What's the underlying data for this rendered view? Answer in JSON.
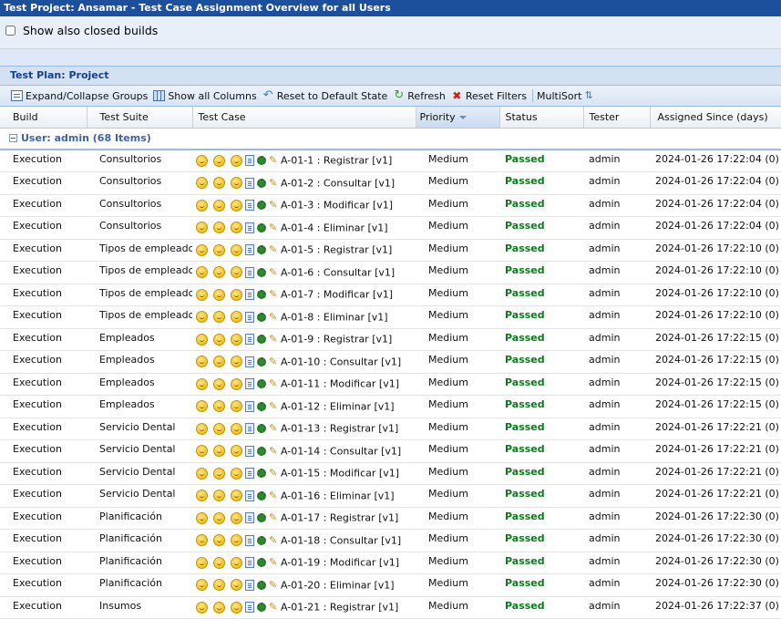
{
  "window": {
    "title": "Test Project: Ansamar - Test Case Assignment Overview for all Users"
  },
  "options": {
    "show_closed_label": "Show also closed builds",
    "show_closed_checked": false
  },
  "panel": {
    "title": "Test Plan: Project"
  },
  "toolbar": {
    "expand_label": "Expand/Collapse Groups",
    "show_columns_label": "Show all Columns",
    "reset_label": "Reset to Default State",
    "refresh_label": "Refresh",
    "reset_filters_label": "Reset Filters",
    "multisort_label": "MultiSort"
  },
  "columns": [
    "Build",
    "Test Suite",
    "Test Case",
    "Priority",
    "Status",
    "Tester",
    "Assigned Since (days)"
  ],
  "sorted_column": "Priority",
  "group": {
    "label": "User: admin (68 Items)"
  },
  "colors": {
    "status_passed": "#0a7a1a",
    "header_bar": "#1c4f9c",
    "group_text": "#3b64a6"
  },
  "rows": [
    {
      "build": "Execution",
      "suite": "Consultorios",
      "testcase": "A-01-1 : Registrar [v1]",
      "priority": "Medium",
      "status": "Passed",
      "tester": "admin",
      "assigned": "2024-01-26 17:22:04 (0)"
    },
    {
      "build": "Execution",
      "suite": "Consultorios",
      "testcase": "A-01-2 : Consultar [v1]",
      "priority": "Medium",
      "status": "Passed",
      "tester": "admin",
      "assigned": "2024-01-26 17:22:04 (0)"
    },
    {
      "build": "Execution",
      "suite": "Consultorios",
      "testcase": "A-01-3 : Modificar [v1]",
      "priority": "Medium",
      "status": "Passed",
      "tester": "admin",
      "assigned": "2024-01-26 17:22:04 (0)"
    },
    {
      "build": "Execution",
      "suite": "Consultorios",
      "testcase": "A-01-4 : Eliminar [v1]",
      "priority": "Medium",
      "status": "Passed",
      "tester": "admin",
      "assigned": "2024-01-26 17:22:04 (0)"
    },
    {
      "build": "Execution",
      "suite": "Tipos de empleados",
      "testcase": "A-01-5 : Registrar [v1]",
      "priority": "Medium",
      "status": "Passed",
      "tester": "admin",
      "assigned": "2024-01-26 17:22:10 (0)"
    },
    {
      "build": "Execution",
      "suite": "Tipos de empleados",
      "testcase": "A-01-6 : Consultar [v1]",
      "priority": "Medium",
      "status": "Passed",
      "tester": "admin",
      "assigned": "2024-01-26 17:22:10 (0)"
    },
    {
      "build": "Execution",
      "suite": "Tipos de empleados",
      "testcase": "A-01-7 : Modificar [v1]",
      "priority": "Medium",
      "status": "Passed",
      "tester": "admin",
      "assigned": "2024-01-26 17:22:10 (0)"
    },
    {
      "build": "Execution",
      "suite": "Tipos de empleados",
      "testcase": "A-01-8 : Eliminar [v1]",
      "priority": "Medium",
      "status": "Passed",
      "tester": "admin",
      "assigned": "2024-01-26 17:22:10 (0)"
    },
    {
      "build": "Execution",
      "suite": "Empleados",
      "testcase": "A-01-9 : Registrar [v1]",
      "priority": "Medium",
      "status": "Passed",
      "tester": "admin",
      "assigned": "2024-01-26 17:22:15 (0)"
    },
    {
      "build": "Execution",
      "suite": "Empleados",
      "testcase": "A-01-10 : Consultar [v1]",
      "priority": "Medium",
      "status": "Passed",
      "tester": "admin",
      "assigned": "2024-01-26 17:22:15 (0)"
    },
    {
      "build": "Execution",
      "suite": "Empleados",
      "testcase": "A-01-11 : Modificar [v1]",
      "priority": "Medium",
      "status": "Passed",
      "tester": "admin",
      "assigned": "2024-01-26 17:22:15 (0)"
    },
    {
      "build": "Execution",
      "suite": "Empleados",
      "testcase": "A-01-12 : Eliminar [v1]",
      "priority": "Medium",
      "status": "Passed",
      "tester": "admin",
      "assigned": "2024-01-26 17:22:15 (0)"
    },
    {
      "build": "Execution",
      "suite": "Servicio Dental",
      "testcase": "A-01-13 : Registrar [v1]",
      "priority": "Medium",
      "status": "Passed",
      "tester": "admin",
      "assigned": "2024-01-26 17:22:21 (0)"
    },
    {
      "build": "Execution",
      "suite": "Servicio Dental",
      "testcase": "A-01-14 : Consultar [v1]",
      "priority": "Medium",
      "status": "Passed",
      "tester": "admin",
      "assigned": "2024-01-26 17:22:21 (0)"
    },
    {
      "build": "Execution",
      "suite": "Servicio Dental",
      "testcase": "A-01-15 : Modificar [v1]",
      "priority": "Medium",
      "status": "Passed",
      "tester": "admin",
      "assigned": "2024-01-26 17:22:21 (0)"
    },
    {
      "build": "Execution",
      "suite": "Servicio Dental",
      "testcase": "A-01-16 : Eliminar [v1]",
      "priority": "Medium",
      "status": "Passed",
      "tester": "admin",
      "assigned": "2024-01-26 17:22:21 (0)"
    },
    {
      "build": "Execution",
      "suite": "Planificación",
      "testcase": "A-01-17 : Registrar [v1]",
      "priority": "Medium",
      "status": "Passed",
      "tester": "admin",
      "assigned": "2024-01-26 17:22:30 (0)"
    },
    {
      "build": "Execution",
      "suite": "Planificación",
      "testcase": "A-01-18 : Consultar [v1]",
      "priority": "Medium",
      "status": "Passed",
      "tester": "admin",
      "assigned": "2024-01-26 17:22:30 (0)"
    },
    {
      "build": "Execution",
      "suite": "Planificación",
      "testcase": "A-01-19 : Modificar [v1]",
      "priority": "Medium",
      "status": "Passed",
      "tester": "admin",
      "assigned": "2024-01-26 17:22:30 (0)"
    },
    {
      "build": "Execution",
      "suite": "Planificación",
      "testcase": "A-01-20 : Eliminar [v1]",
      "priority": "Medium",
      "status": "Passed",
      "tester": "admin",
      "assigned": "2024-01-26 17:22:30 (0)"
    },
    {
      "build": "Execution",
      "suite": "Insumos",
      "testcase": "A-01-21 : Registrar [v1]",
      "priority": "Medium",
      "status": "Passed",
      "tester": "admin",
      "assigned": "2024-01-26 17:22:37 (0)"
    }
  ]
}
